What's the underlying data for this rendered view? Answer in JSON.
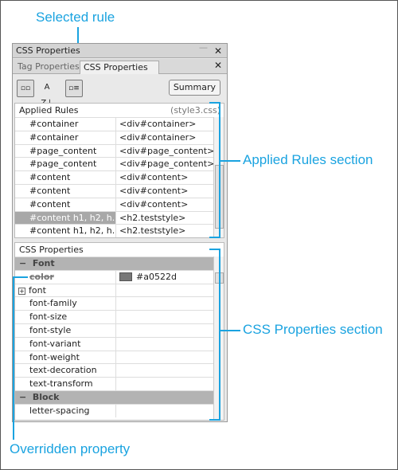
{
  "callouts": {
    "selected_rule": "Selected rule",
    "applied_rules_section": "Applied Rules section",
    "css_properties_section": "CSS Properties section",
    "overridden_property": "Overridden property"
  },
  "panel": {
    "title": "CSS Properties",
    "tabs": [
      {
        "label": "Tag Properties",
        "active": false
      },
      {
        "label": "CSS Properties",
        "active": true
      }
    ],
    "summary_label": "Summary",
    "sort_icon_label": "A Z"
  },
  "applied_rules": {
    "title": "Applied Rules",
    "source": "(style3.css)",
    "rows": [
      {
        "rule": "#container",
        "tag": "<div#container>"
      },
      {
        "rule": "#container",
        "tag": "<div#container>"
      },
      {
        "rule": "#page_content",
        "tag": "<div#page_content>"
      },
      {
        "rule": "#page_content",
        "tag": "<div#page_content>"
      },
      {
        "rule": "#content",
        "tag": "<div#content>"
      },
      {
        "rule": "#content",
        "tag": "<div#content>"
      },
      {
        "rule": "#content",
        "tag": "<div#content>"
      },
      {
        "rule": "#content h1, h2, h...",
        "tag": "<h2.teststyle>",
        "selected": true
      },
      {
        "rule": "#content h1, h2, h...",
        "tag": "<h2.teststyle>"
      }
    ]
  },
  "css_properties": {
    "title": "CSS Properties",
    "categories": [
      {
        "name": "Font",
        "props": [
          {
            "name": "color",
            "value": "#a0522d",
            "overridden": true
          },
          {
            "name": "font",
            "expandable": true
          },
          {
            "name": "font-family"
          },
          {
            "name": "font-size"
          },
          {
            "name": "font-style"
          },
          {
            "name": "font-variant"
          },
          {
            "name": "font-weight"
          },
          {
            "name": "text-decoration"
          },
          {
            "name": "text-transform"
          }
        ]
      },
      {
        "name": "Block",
        "props": [
          {
            "name": "letter-spacing"
          }
        ]
      }
    ]
  },
  "colors": {
    "callout": "#1aa3e0",
    "color_swatch": "#777777"
  }
}
